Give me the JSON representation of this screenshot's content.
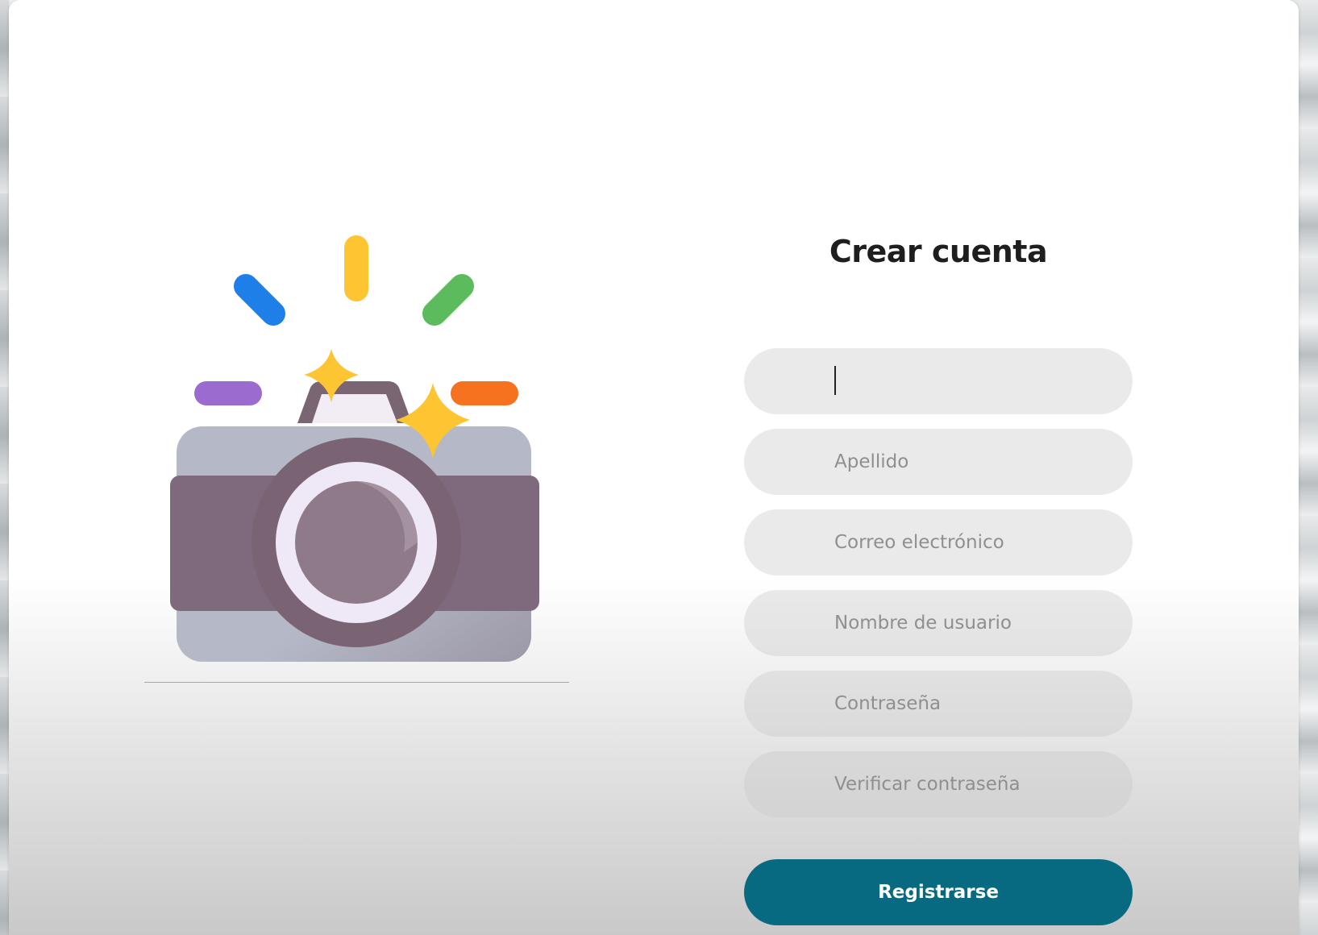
{
  "form": {
    "title": "Crear cuenta",
    "fields": [
      {
        "placeholder": "",
        "value": ""
      },
      {
        "placeholder": "Apellido",
        "value": ""
      },
      {
        "placeholder": "Correo electrónico",
        "value": ""
      },
      {
        "placeholder": "Nombre de usuario",
        "value": ""
      },
      {
        "placeholder": "Contraseña",
        "value": ""
      },
      {
        "placeholder": "Verificar contraseña",
        "value": ""
      }
    ],
    "submit_label": "Registrarse"
  },
  "illustration": {
    "icon": "camera-icon",
    "colors": {
      "blue": "#1e7fe8",
      "yellow": "#fcc531",
      "green": "#5cbb5c",
      "purple": "#9c6bd0",
      "orange": "#f6721e",
      "body_gray": "#b2b6c3",
      "body_mauve": "#7e6a7c"
    }
  },
  "colors": {
    "primary": "#076a80",
    "field_bg": "#e2e2e2",
    "title": "#1e1e1e"
  }
}
